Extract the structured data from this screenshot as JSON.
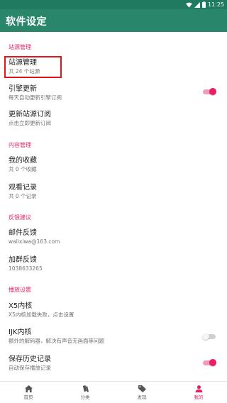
{
  "status_bar": {
    "time": "11:25",
    "icons": [
      "wifi-icon",
      "signal-icon",
      "battery-icon"
    ]
  },
  "app_bar": {
    "title": "软件设定"
  },
  "sections": {
    "source": {
      "header": "站源管理",
      "manage": {
        "title": "站源管理",
        "subtitle": "共 24 个站源"
      },
      "engine_update": {
        "title": "引擎更新",
        "subtitle": "每天自动更新引擎订阅",
        "enabled": true
      },
      "update_subscription": {
        "title": "更新站源订阅",
        "subtitle": "点击立即更新订阅"
      }
    },
    "content": {
      "header": "内容管理",
      "favorites": {
        "title": "我的收藏",
        "subtitle": "共 0 个收藏"
      },
      "history": {
        "title": "观看记录",
        "subtitle": "共 0 个记录"
      }
    },
    "feedback": {
      "header": "反馈建议",
      "email": {
        "title": "邮件反馈",
        "subtitle": "walixiwa@163.com"
      },
      "group": {
        "title": "加群反馈",
        "subtitle": "1038633265"
      }
    },
    "playback": {
      "header": "播放设置",
      "x5": {
        "title": "X5内核",
        "subtitle": "X5内核加载失败，点击设置"
      },
      "ijk": {
        "title": "IJK内核",
        "subtitle": "额外的解码器，解决有声音无画面等问题",
        "enabled": false
      },
      "save_history": {
        "title": "保存历史记录",
        "subtitle": "自动保存播放记录",
        "enabled": true
      }
    }
  },
  "bottom_nav": [
    {
      "label": "首页",
      "icon": "home-icon",
      "active": false
    },
    {
      "label": "分类",
      "icon": "category-icon",
      "active": false
    },
    {
      "label": "发现",
      "icon": "tag-icon",
      "active": false
    },
    {
      "label": "我的",
      "icon": "person-icon",
      "active": true
    }
  ],
  "colors": {
    "primary": "#29866a",
    "status_bar": "#1f7a60",
    "accent": "#e91e63",
    "highlight_box": "#e0151a"
  }
}
